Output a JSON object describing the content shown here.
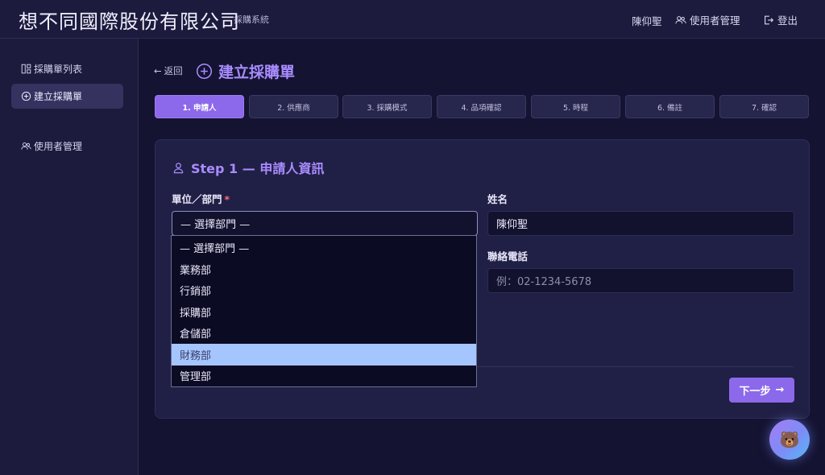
{
  "header": {
    "company": "想不同國際股份有限公司",
    "system": "採購系統",
    "user": "陳仰聖",
    "user_mgmt": "使用者管理",
    "logout": "登出"
  },
  "sidebar": {
    "items": [
      {
        "label": "採購單列表",
        "icon": "list-icon"
      },
      {
        "label": "建立採購單",
        "icon": "plus-circle-icon"
      },
      {
        "label": "使用者管理",
        "icon": "users-icon"
      }
    ]
  },
  "main": {
    "back": "返回",
    "title": "建立採購單",
    "steps": [
      "1. 申請人",
      "2. 供應商",
      "3. 採購模式",
      "4. 品項確認",
      "5. 時程",
      "6. 備註",
      "7. 確認"
    ],
    "active_step": 1,
    "card": {
      "title": "Step 1 — 申請人資訊",
      "dept_label": "單位／部門",
      "dept_required": "*",
      "dept_value": "— 選擇部門 —",
      "name_label": "姓名",
      "name_value": "陳仰聖",
      "phone_label": "聯絡電話",
      "phone_placeholder": "例：02-1234-5678",
      "next_label": "下一步"
    }
  },
  "dropdown": {
    "options": [
      "— 選擇部門 —",
      "業務部",
      "行銷部",
      "採購部",
      "倉儲部",
      "財務部",
      "管理部"
    ],
    "highlighted": "財務部"
  },
  "assistant": {
    "icon": "bear-icon",
    "glyph": "🐻"
  },
  "colors": {
    "accent": "#8c69ea",
    "accent_text": "#a98cff",
    "background": "#141331",
    "panel": "#1c1b3d",
    "highlight": "#a5c5ff",
    "required": "#ff6b7a"
  }
}
